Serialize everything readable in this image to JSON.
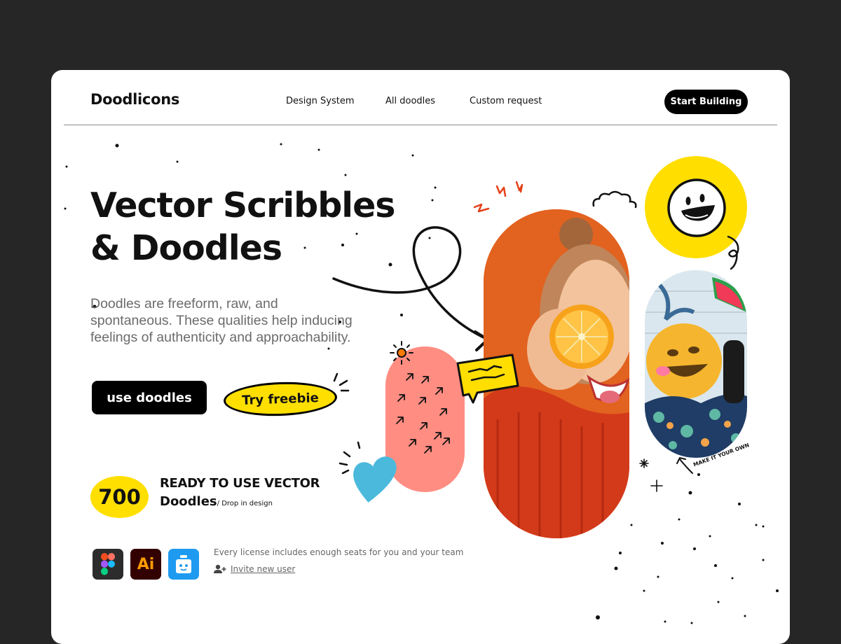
{
  "app": {
    "logo": "Doodlicons"
  },
  "nav": {
    "items": [
      {
        "label": "Design System"
      },
      {
        "label": "All doodles"
      },
      {
        "label": "Custom request"
      }
    ],
    "cta_label": "Start Building"
  },
  "hero": {
    "title_line1": "Vector Scribbles",
    "title_line2": "& Doodles",
    "description": "Doodles are freeform, raw, and spontaneous. These qualities help inducing feelings of authenticity and approachability.",
    "primary_button": "use doodles",
    "secondary_button": "Try freebie"
  },
  "stats": {
    "count": "700",
    "headline": "READY TO USE VECTOR",
    "subhead": "Doodles",
    "note": "/ Drop in design"
  },
  "tools": {
    "icons": [
      "figma-icon",
      "illustrator-icon",
      "craft-jar-icon"
    ],
    "illustrator_text": "Ai",
    "license_text": "Every license includes enough seats for you and your team",
    "invite_label": "Invite new user"
  },
  "art": {
    "make_it_text": "MAKE IT YOUR OWN"
  },
  "colors": {
    "accent_yellow": "#ffdf00",
    "orange": "#e2621f",
    "pink": "#ff8d82",
    "blue": "#4ab9dc",
    "dark_bg": "#262626"
  }
}
